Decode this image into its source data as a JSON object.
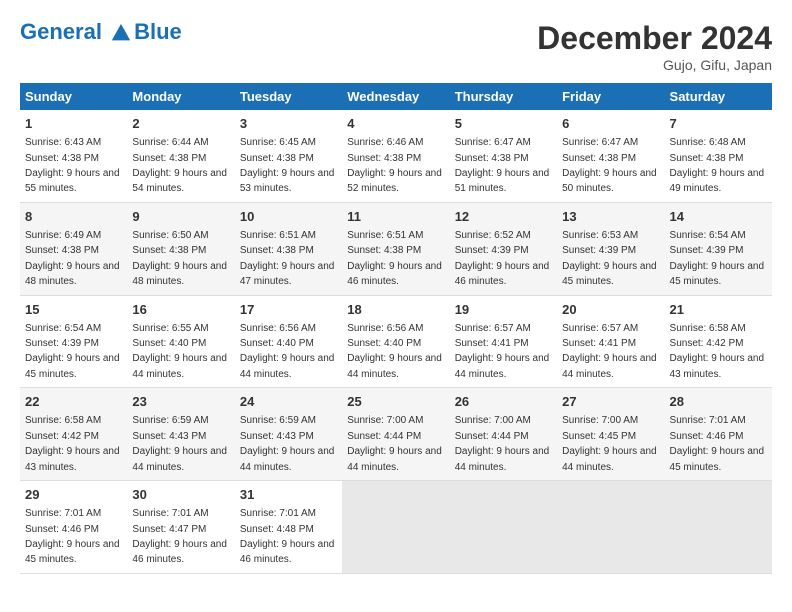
{
  "header": {
    "logo_line1": "General",
    "logo_line2": "Blue",
    "title": "December 2024",
    "subtitle": "Gujo, Gifu, Japan"
  },
  "days_of_week": [
    "Sunday",
    "Monday",
    "Tuesday",
    "Wednesday",
    "Thursday",
    "Friday",
    "Saturday"
  ],
  "weeks": [
    [
      {
        "day": 1,
        "sunrise": "6:43 AM",
        "sunset": "4:38 PM",
        "daylight": "9 hours and 55 minutes."
      },
      {
        "day": 2,
        "sunrise": "6:44 AM",
        "sunset": "4:38 PM",
        "daylight": "9 hours and 54 minutes."
      },
      {
        "day": 3,
        "sunrise": "6:45 AM",
        "sunset": "4:38 PM",
        "daylight": "9 hours and 53 minutes."
      },
      {
        "day": 4,
        "sunrise": "6:46 AM",
        "sunset": "4:38 PM",
        "daylight": "9 hours and 52 minutes."
      },
      {
        "day": 5,
        "sunrise": "6:47 AM",
        "sunset": "4:38 PM",
        "daylight": "9 hours and 51 minutes."
      },
      {
        "day": 6,
        "sunrise": "6:47 AM",
        "sunset": "4:38 PM",
        "daylight": "9 hours and 50 minutes."
      },
      {
        "day": 7,
        "sunrise": "6:48 AM",
        "sunset": "4:38 PM",
        "daylight": "9 hours and 49 minutes."
      }
    ],
    [
      {
        "day": 8,
        "sunrise": "6:49 AM",
        "sunset": "4:38 PM",
        "daylight": "9 hours and 48 minutes."
      },
      {
        "day": 9,
        "sunrise": "6:50 AM",
        "sunset": "4:38 PM",
        "daylight": "9 hours and 48 minutes."
      },
      {
        "day": 10,
        "sunrise": "6:51 AM",
        "sunset": "4:38 PM",
        "daylight": "9 hours and 47 minutes."
      },
      {
        "day": 11,
        "sunrise": "6:51 AM",
        "sunset": "4:38 PM",
        "daylight": "9 hours and 46 minutes."
      },
      {
        "day": 12,
        "sunrise": "6:52 AM",
        "sunset": "4:39 PM",
        "daylight": "9 hours and 46 minutes."
      },
      {
        "day": 13,
        "sunrise": "6:53 AM",
        "sunset": "4:39 PM",
        "daylight": "9 hours and 45 minutes."
      },
      {
        "day": 14,
        "sunrise": "6:54 AM",
        "sunset": "4:39 PM",
        "daylight": "9 hours and 45 minutes."
      }
    ],
    [
      {
        "day": 15,
        "sunrise": "6:54 AM",
        "sunset": "4:39 PM",
        "daylight": "9 hours and 45 minutes."
      },
      {
        "day": 16,
        "sunrise": "6:55 AM",
        "sunset": "4:40 PM",
        "daylight": "9 hours and 44 minutes."
      },
      {
        "day": 17,
        "sunrise": "6:56 AM",
        "sunset": "4:40 PM",
        "daylight": "9 hours and 44 minutes."
      },
      {
        "day": 18,
        "sunrise": "6:56 AM",
        "sunset": "4:40 PM",
        "daylight": "9 hours and 44 minutes."
      },
      {
        "day": 19,
        "sunrise": "6:57 AM",
        "sunset": "4:41 PM",
        "daylight": "9 hours and 44 minutes."
      },
      {
        "day": 20,
        "sunrise": "6:57 AM",
        "sunset": "4:41 PM",
        "daylight": "9 hours and 44 minutes."
      },
      {
        "day": 21,
        "sunrise": "6:58 AM",
        "sunset": "4:42 PM",
        "daylight": "9 hours and 43 minutes."
      }
    ],
    [
      {
        "day": 22,
        "sunrise": "6:58 AM",
        "sunset": "4:42 PM",
        "daylight": "9 hours and 43 minutes."
      },
      {
        "day": 23,
        "sunrise": "6:59 AM",
        "sunset": "4:43 PM",
        "daylight": "9 hours and 44 minutes."
      },
      {
        "day": 24,
        "sunrise": "6:59 AM",
        "sunset": "4:43 PM",
        "daylight": "9 hours and 44 minutes."
      },
      {
        "day": 25,
        "sunrise": "7:00 AM",
        "sunset": "4:44 PM",
        "daylight": "9 hours and 44 minutes."
      },
      {
        "day": 26,
        "sunrise": "7:00 AM",
        "sunset": "4:44 PM",
        "daylight": "9 hours and 44 minutes."
      },
      {
        "day": 27,
        "sunrise": "7:00 AM",
        "sunset": "4:45 PM",
        "daylight": "9 hours and 44 minutes."
      },
      {
        "day": 28,
        "sunrise": "7:01 AM",
        "sunset": "4:46 PM",
        "daylight": "9 hours and 45 minutes."
      }
    ],
    [
      {
        "day": 29,
        "sunrise": "7:01 AM",
        "sunset": "4:46 PM",
        "daylight": "9 hours and 45 minutes."
      },
      {
        "day": 30,
        "sunrise": "7:01 AM",
        "sunset": "4:47 PM",
        "daylight": "9 hours and 46 minutes."
      },
      {
        "day": 31,
        "sunrise": "7:01 AM",
        "sunset": "4:48 PM",
        "daylight": "9 hours and 46 minutes."
      },
      null,
      null,
      null,
      null
    ]
  ]
}
